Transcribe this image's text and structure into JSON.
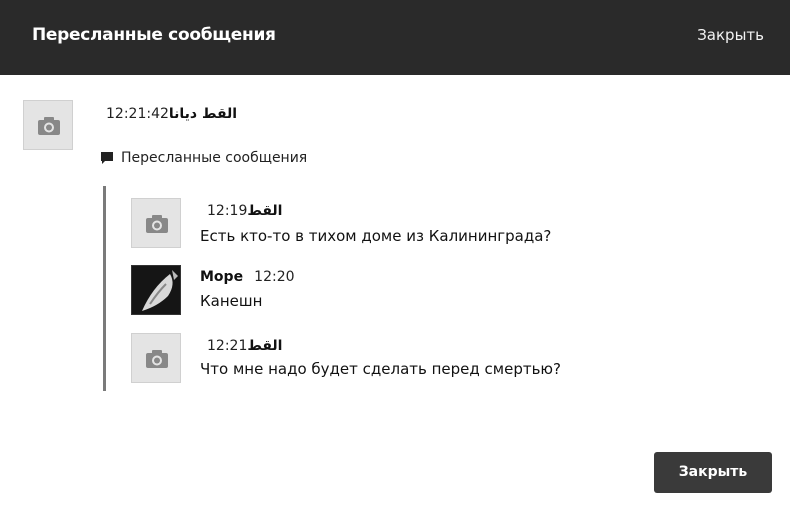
{
  "header": {
    "title": "Пересланные сообщения",
    "close_label": "Закрыть"
  },
  "main_message": {
    "time": "12:21:42",
    "author": "القط ديانا",
    "avatar_icon": "camera-icon"
  },
  "forwarded_label": "Пересланные сообщения",
  "forwarded_messages": [
    {
      "time": "12:19",
      "author": "القط",
      "text": "Есть кто-то в тихом доме из Калининграда?",
      "avatar_icon": "camera-icon"
    },
    {
      "time": "12:20",
      "author": "Море",
      "text": "Канешн",
      "avatar_icon": "photo"
    },
    {
      "time": "12:21",
      "author": "القط",
      "text": "Что мне надо будет сделать перед смертью?",
      "avatar_icon": "camera-icon"
    }
  ],
  "footer": {
    "close_button_label": "Закрыть"
  }
}
